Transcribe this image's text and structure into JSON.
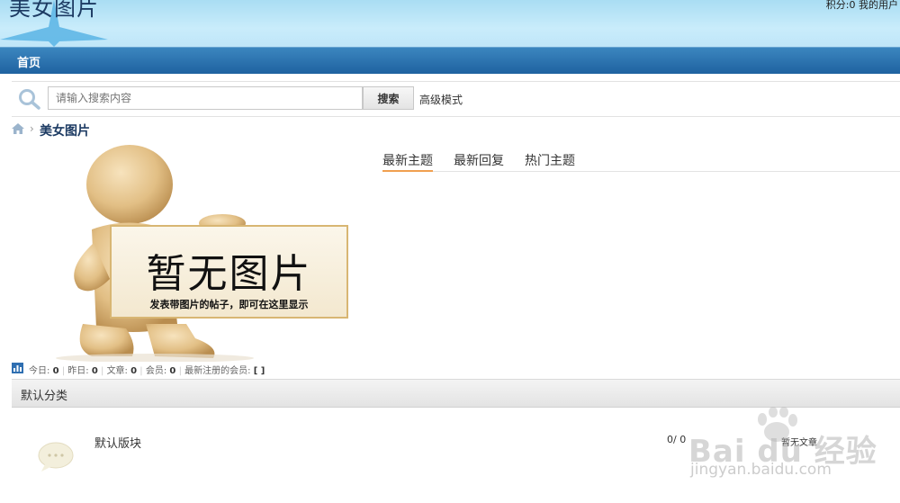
{
  "header": {
    "site_title": "美女图片",
    "user_info": "积分:0 我的用户"
  },
  "nav": {
    "home": "首页"
  },
  "search": {
    "placeholder": "请输入搜索内容",
    "button": "搜索",
    "advanced": "高级模式"
  },
  "breadcrumb": {
    "separator": "›",
    "current": "美女图片"
  },
  "noimage": {
    "title": "暂无图片",
    "subtitle": "发表带图片的帖子，即可在这里显示"
  },
  "tabs": [
    {
      "label": "最新主题",
      "active": true
    },
    {
      "label": "最新回复",
      "active": false
    },
    {
      "label": "热门主题",
      "active": false
    }
  ],
  "stats": {
    "today_label": "今日:",
    "today": "0",
    "yesterday_label": "昨日:",
    "yesterday": "0",
    "posts_label": "文章:",
    "posts": "0",
    "members_label": "会员:",
    "members": "0",
    "newest_label": "最新注册的会员:",
    "newest": "[ ]"
  },
  "category": {
    "title": "默认分类"
  },
  "forum": {
    "name": "默认版块",
    "counts": "0/ 0",
    "last_post": "暂无文章"
  },
  "watermark": {
    "main": "Bai du 经验",
    "url": "jingyan.baidu.com"
  },
  "colors": {
    "nav_bg": "#1f62a0",
    "header_bg": "#bfe6f8",
    "tab_active": "#f0a050",
    "title_text": "#1d3b63"
  }
}
